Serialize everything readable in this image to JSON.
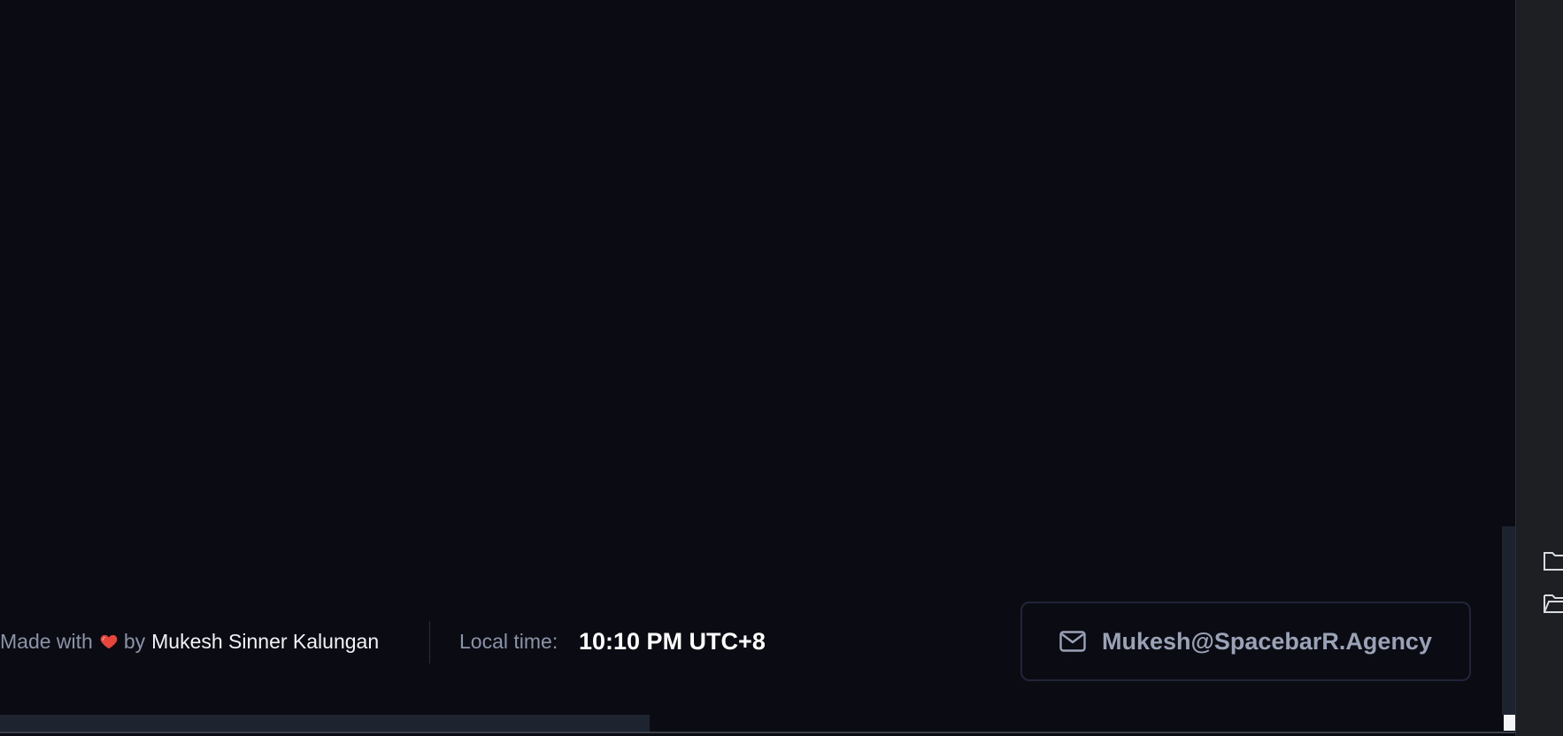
{
  "footer": {
    "made_with": "Made with",
    "heart_icon": "heart-icon",
    "by": "by",
    "author": "Mukesh Sinner Kalungan",
    "local_time_label": "Local time:",
    "local_time_value": "10:10 PM UTC+8",
    "email": "Mukesh@SpacebarR.Agency",
    "email_icon": "mail-icon"
  },
  "colors": {
    "background": "#0b0c13",
    "muted_text": "#8b93a7",
    "bright_text": "#ffffff",
    "heart": "#e8453c",
    "button_border": "#22253a",
    "side_panel": "#1d1f23"
  },
  "side_panel": {
    "icons": [
      "file-icon-orange",
      "file-icon-gray",
      "file-icon-blue",
      "file-icon-yellow",
      "file-icon-red",
      "file-icon-yellow-gray",
      "file-icon-yellow",
      "file-icon-yellow",
      "file-icon-gray",
      "file-icon-blue",
      "file-icon-orange",
      "folder-icon",
      "folder-open-icon",
      "file-icon-gray",
      "file-icon-gray",
      "file-icon-gray"
    ]
  }
}
